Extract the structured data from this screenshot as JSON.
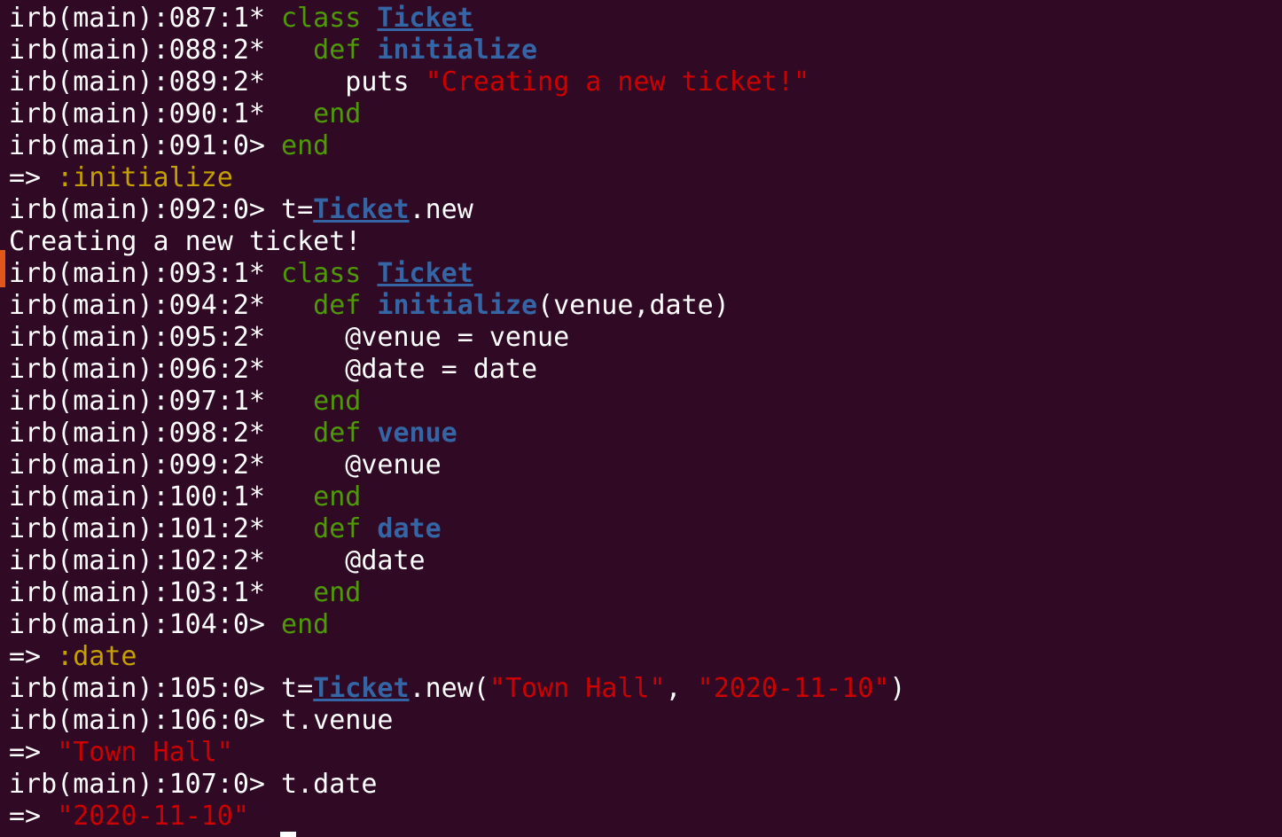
{
  "terminal": {
    "colors": {
      "background": "#300a24",
      "text": "#ffffff",
      "keyword": "#4e9a06",
      "constant": "#3465a4",
      "string": "#cc0000",
      "symbol": "#c4a000"
    },
    "lines": [
      [
        {
          "t": "irb(main):087:1* ",
          "c": "prompt"
        },
        {
          "t": "class",
          "c": "kw"
        },
        {
          "t": " ",
          "c": "plain"
        },
        {
          "t": "Ticket",
          "c": "const"
        }
      ],
      [
        {
          "t": "irb(main):088:2* ",
          "c": "prompt"
        },
        {
          "t": "  ",
          "c": "plain"
        },
        {
          "t": "def",
          "c": "kw"
        },
        {
          "t": " ",
          "c": "plain"
        },
        {
          "t": "initialize",
          "c": "def"
        }
      ],
      [
        {
          "t": "irb(main):089:2* ",
          "c": "prompt"
        },
        {
          "t": "    puts ",
          "c": "plain"
        },
        {
          "t": "\"Creating a new ticket!\"",
          "c": "str"
        }
      ],
      [
        {
          "t": "irb(main):090:1* ",
          "c": "prompt"
        },
        {
          "t": "  ",
          "c": "plain"
        },
        {
          "t": "end",
          "c": "kw"
        }
      ],
      [
        {
          "t": "irb(main):091:0> ",
          "c": "prompt"
        },
        {
          "t": "end",
          "c": "kw"
        }
      ],
      [
        {
          "t": "=> ",
          "c": "arrow"
        },
        {
          "t": ":initialize",
          "c": "sym"
        }
      ],
      [
        {
          "t": "irb(main):092:0> ",
          "c": "prompt"
        },
        {
          "t": "t=",
          "c": "plain"
        },
        {
          "t": "Ticket",
          "c": "const"
        },
        {
          "t": ".new",
          "c": "plain"
        }
      ],
      [
        {
          "t": "Creating a new ticket!",
          "c": "plain"
        }
      ],
      [
        {
          "t": "irb(main):093:1* ",
          "c": "prompt"
        },
        {
          "t": "class",
          "c": "kw"
        },
        {
          "t": " ",
          "c": "plain"
        },
        {
          "t": "Ticket",
          "c": "const"
        }
      ],
      [
        {
          "t": "irb(main):094:2* ",
          "c": "prompt"
        },
        {
          "t": "  ",
          "c": "plain"
        },
        {
          "t": "def",
          "c": "kw"
        },
        {
          "t": " ",
          "c": "plain"
        },
        {
          "t": "initialize",
          "c": "def"
        },
        {
          "t": "(venue,date)",
          "c": "plain"
        }
      ],
      [
        {
          "t": "irb(main):095:2* ",
          "c": "prompt"
        },
        {
          "t": "    @venue = venue",
          "c": "plain"
        }
      ],
      [
        {
          "t": "irb(main):096:2* ",
          "c": "prompt"
        },
        {
          "t": "    @date = date",
          "c": "plain"
        }
      ],
      [
        {
          "t": "irb(main):097:1* ",
          "c": "prompt"
        },
        {
          "t": "  ",
          "c": "plain"
        },
        {
          "t": "end",
          "c": "kw"
        }
      ],
      [
        {
          "t": "irb(main):098:2* ",
          "c": "prompt"
        },
        {
          "t": "  ",
          "c": "plain"
        },
        {
          "t": "def",
          "c": "kw"
        },
        {
          "t": " ",
          "c": "plain"
        },
        {
          "t": "venue",
          "c": "def"
        }
      ],
      [
        {
          "t": "irb(main):099:2* ",
          "c": "prompt"
        },
        {
          "t": "    @venue",
          "c": "plain"
        }
      ],
      [
        {
          "t": "irb(main):100:1* ",
          "c": "prompt"
        },
        {
          "t": "  ",
          "c": "plain"
        },
        {
          "t": "end",
          "c": "kw"
        }
      ],
      [
        {
          "t": "irb(main):101:2* ",
          "c": "prompt"
        },
        {
          "t": "  ",
          "c": "plain"
        },
        {
          "t": "def",
          "c": "kw"
        },
        {
          "t": " ",
          "c": "plain"
        },
        {
          "t": "date",
          "c": "def"
        }
      ],
      [
        {
          "t": "irb(main):102:2* ",
          "c": "prompt"
        },
        {
          "t": "    @date",
          "c": "plain"
        }
      ],
      [
        {
          "t": "irb(main):103:1* ",
          "c": "prompt"
        },
        {
          "t": "  ",
          "c": "plain"
        },
        {
          "t": "end",
          "c": "kw"
        }
      ],
      [
        {
          "t": "irb(main):104:0> ",
          "c": "prompt"
        },
        {
          "t": "end",
          "c": "kw"
        }
      ],
      [
        {
          "t": "=> ",
          "c": "arrow"
        },
        {
          "t": ":date",
          "c": "sym"
        }
      ],
      [
        {
          "t": "irb(main):105:0> ",
          "c": "prompt"
        },
        {
          "t": "t=",
          "c": "plain"
        },
        {
          "t": "Ticket",
          "c": "const"
        },
        {
          "t": ".new(",
          "c": "plain"
        },
        {
          "t": "\"Town Hall\"",
          "c": "str"
        },
        {
          "t": ", ",
          "c": "plain"
        },
        {
          "t": "\"2020-11-10\"",
          "c": "str"
        },
        {
          "t": ")",
          "c": "plain"
        }
      ],
      [
        {
          "t": "irb(main):106:0> ",
          "c": "prompt"
        },
        {
          "t": "t.venue",
          "c": "plain"
        }
      ],
      [
        {
          "t": "=> ",
          "c": "arrow"
        },
        {
          "t": "\"Town Hall\"",
          "c": "str"
        }
      ],
      [
        {
          "t": "irb(main):107:0> ",
          "c": "prompt"
        },
        {
          "t": "t.date",
          "c": "plain"
        }
      ],
      [
        {
          "t": "=> ",
          "c": "arrow"
        },
        {
          "t": "\"2020-11-10\"",
          "c": "str"
        }
      ]
    ]
  }
}
